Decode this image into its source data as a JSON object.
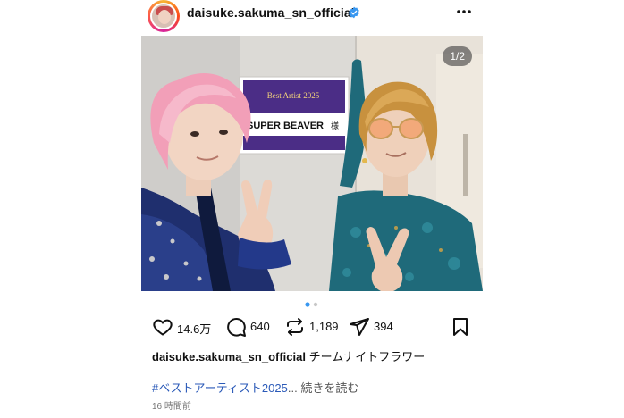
{
  "header": {
    "username": "daisuke.sakuma_sn_official",
    "avatar_icon": "profile-avatar",
    "verified_icon": "verified-badge-icon",
    "more_icon": "more-options-icon"
  },
  "photo": {
    "pager": "1/2",
    "sign_text": "SUPER BEAVER",
    "sign_suffix": "様",
    "sign_logo": "Best Artist 2025"
  },
  "carousel": {
    "current": 1,
    "total": 2
  },
  "actions": {
    "likes": "14.6万",
    "comments": "640",
    "reposts": "1,189",
    "shares": "394"
  },
  "caption": {
    "username": "daisuke.sakuma_sn_official",
    "text": "チームナイトフラワー",
    "hashtag": "#ベストアーティスト2025",
    "ellipsis": "...",
    "read_more": "続きを読む",
    "timestamp": "16 時間前"
  },
  "colors": {
    "link": "#2b5ab8",
    "verified": "#3897f0",
    "sign_purple": "#4b2d86"
  }
}
